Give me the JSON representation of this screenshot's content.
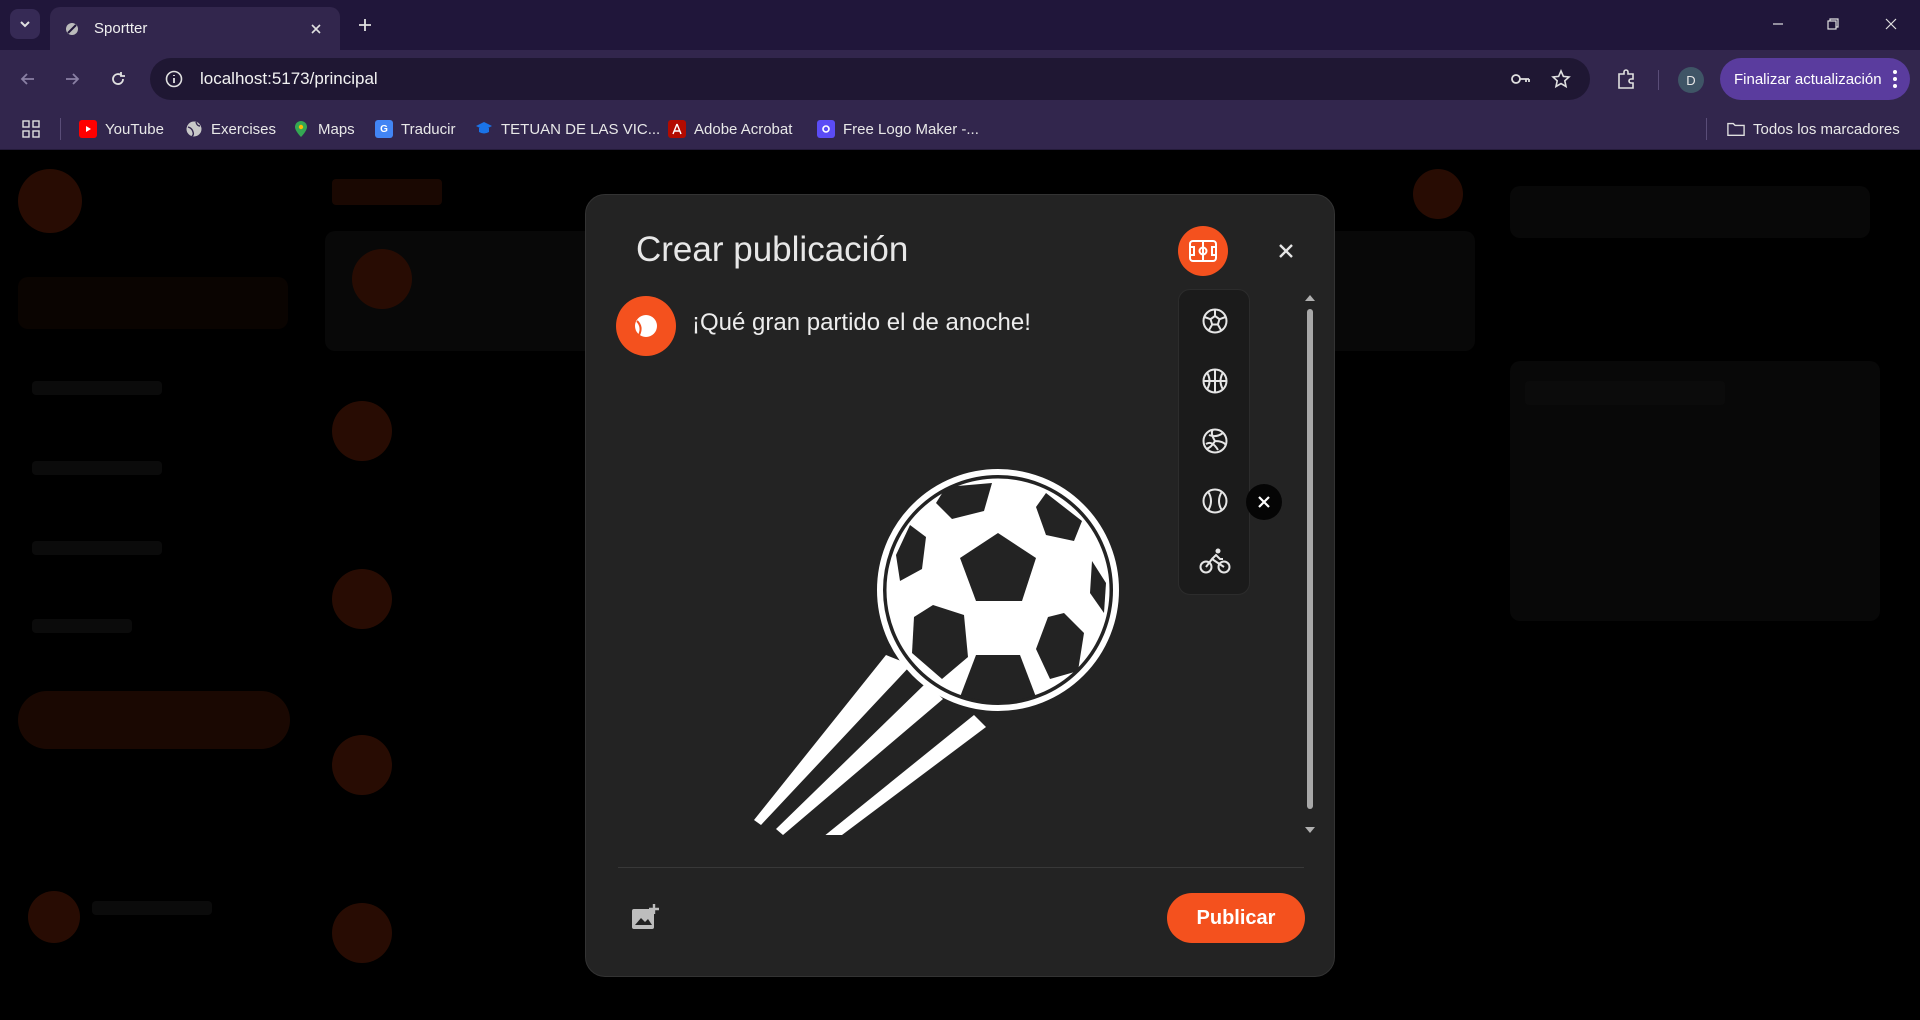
{
  "browser": {
    "tab_title": "Sportter",
    "url": "localhost:5173/principal",
    "profile_initial": "D",
    "update_label": "Finalizar actualización",
    "bookmarks": [
      {
        "label": "YouTube",
        "icon": "youtube-icon",
        "color": "#ff0000"
      },
      {
        "label": "Exercises",
        "icon": "globe-icon",
        "color": "#c8c8c8"
      },
      {
        "label": "Maps",
        "icon": "maps-icon",
        "color": "#34a853"
      },
      {
        "label": "Traducir",
        "icon": "translate-icon",
        "color": "#4285f4"
      },
      {
        "label": "TETUAN DE LAS VIC...",
        "icon": "school-icon",
        "color": "#1a73e8"
      },
      {
        "label": "Adobe Acrobat",
        "icon": "acrobat-icon",
        "color": "#d32f2f"
      },
      {
        "label": "Free Logo Maker -...",
        "icon": "logo-maker-icon",
        "color": "#5b4cf5"
      }
    ],
    "all_bookmarks": "Todos los marcadores"
  },
  "modal": {
    "title": "Crear publicación",
    "post_text": "¡Qué gran partido el de anoche!",
    "publish_label": "Publicar",
    "accent": "#f4511e",
    "sports": [
      "soccer-icon",
      "basketball-icon",
      "volleyball-icon",
      "tennis-icon",
      "cycling-icon"
    ],
    "attached_image": "soccer-ball-image"
  }
}
